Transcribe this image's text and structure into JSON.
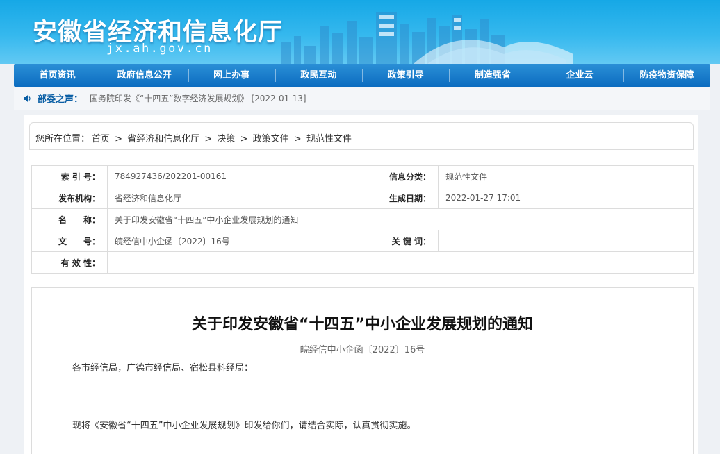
{
  "header": {
    "site_title": "安徽省经济和信息化厅",
    "site_domain": "jx.ah.gov.cn",
    "accent_color": "#1aa5e6"
  },
  "nav": {
    "items": [
      "首页资讯",
      "政府信息公开",
      "网上办事",
      "政民互动",
      "政策引导",
      "制造强省",
      "企业云",
      "防疫物资保障"
    ],
    "color": "#0c6cc0"
  },
  "notice": {
    "label": "部委之声：",
    "link_text": "国务院印发《“十四五”数字经济发展规划》",
    "date": "[2022-01-13]"
  },
  "breadcrumb": {
    "prefix": "您所在位置：",
    "items": [
      "首页",
      "省经济和信息化厅",
      "决策",
      "政策文件",
      "规范性文件"
    ],
    "separator": ">"
  },
  "info": {
    "index_label": "索 引 号：",
    "index_value": "784927436/202201-00161",
    "category_label": "信息分类：",
    "category_value": "规范性文件",
    "publisher_label": "发布机构：",
    "publisher_value": "省经济和信息化厅",
    "date_label": "生成日期：",
    "date_value": "2022-01-27 17:01",
    "name_label": "名　　称：",
    "name_value": "关于印发安徽省“十四五”中小企业发展规划的通知",
    "docno_label": "文　　号：",
    "docno_value": "皖经信中小企函〔2022〕16号",
    "keyword_label": "关 键 词：",
    "keyword_value": "",
    "validity_label": "有 效 性：",
    "validity_value": ""
  },
  "article": {
    "title": "关于印发安徽省“十四五”中小企业发展规划的通知",
    "doc_number": "皖经信中小企函〔2022〕16号",
    "salutation": "各市经信局，广德市经信局、宿松县科经局：",
    "body": "现将《安徽省“十四五”中小企业发展规划》印发给你们，请结合实际，认真贯彻实施。"
  }
}
